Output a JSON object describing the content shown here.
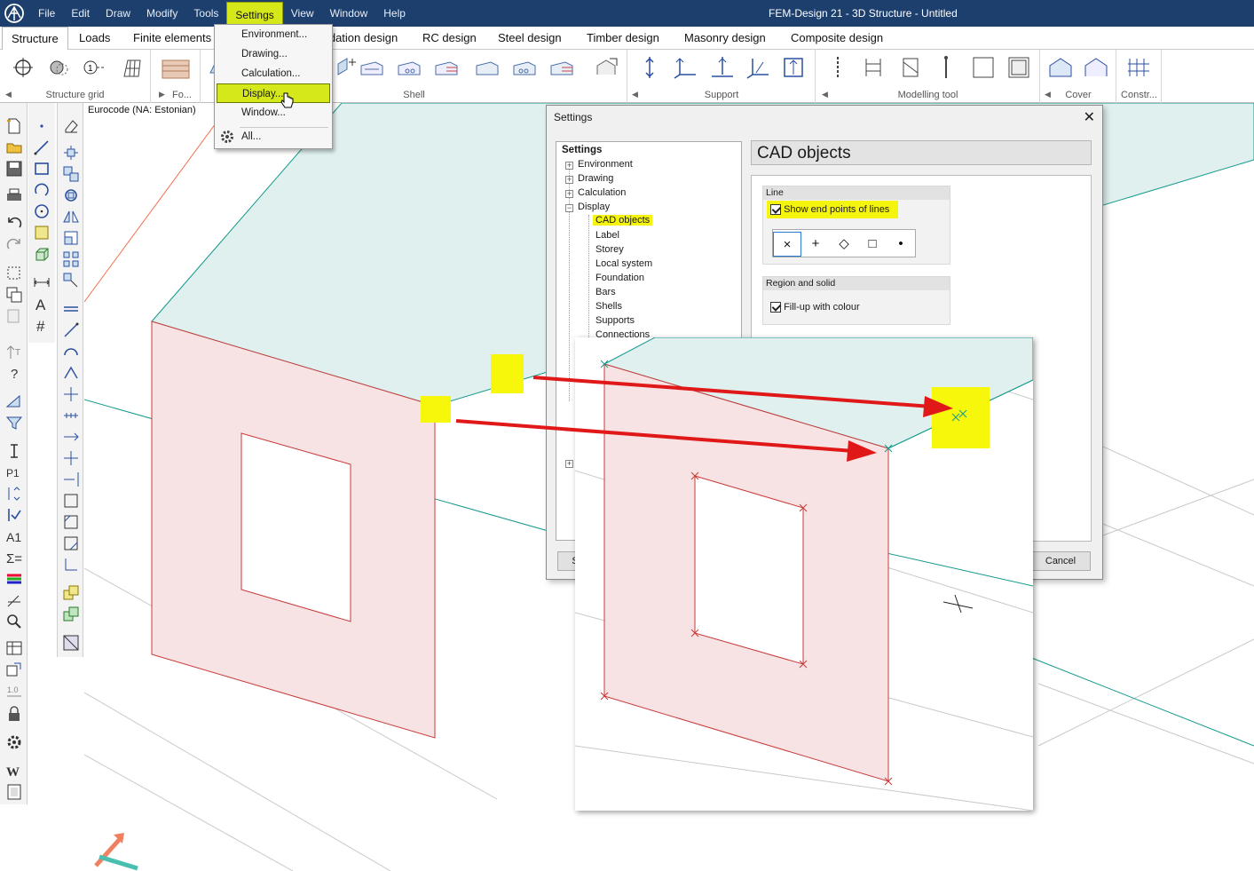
{
  "window": {
    "title": "FEM-Design 21 - 3D Structure - Untitled"
  },
  "menu": [
    "File",
    "Edit",
    "Draw",
    "Modify",
    "Tools",
    "Settings",
    "View",
    "Window",
    "Help"
  ],
  "menu_active": "Settings",
  "ribbon": {
    "tabs": [
      "Structure",
      "Loads",
      "Finite elements",
      "...dation design",
      "RC design",
      "Steel design",
      "Timber design",
      "Masonry design",
      "Composite design"
    ],
    "groups": [
      "Structure grid",
      "Fo...",
      "Shell",
      "Support",
      "Modelling tool",
      "Cover",
      "Constr..."
    ]
  },
  "settings_dropdown": {
    "items": [
      "Environment...",
      "Drawing...",
      "Calculation...",
      "Display...",
      "Window...",
      "All..."
    ],
    "highlighted": "Display..."
  },
  "viewport": {
    "code_label": "Eurocode (NA: Estonian)"
  },
  "dialog": {
    "title": "Settings",
    "tree_root": "Settings",
    "tree_items": [
      "Environment",
      "Drawing",
      "Calculation",
      "Display",
      "CAD objects",
      "Label",
      "Storey",
      "Local system",
      "Foundation",
      "Bars",
      "Shells",
      "Supports",
      "Connections"
    ],
    "selected_item": "CAD objects",
    "panel_title": "CAD objects",
    "line_group": {
      "title": "Line",
      "checkbox_label": "Show end points of lines",
      "checked": true,
      "marker_options": [
        "×",
        "+",
        "◇",
        "□",
        "•"
      ],
      "selected_marker": "×"
    },
    "region_group": {
      "title": "Region and solid",
      "checkbox_label": "Fill-up with colour",
      "checked": true
    },
    "buttons": {
      "left_partial": "S",
      "cancel": "Cancel"
    }
  },
  "colors": {
    "title_bar": "#1c3f6e",
    "highlight": "#d4e81a",
    "annotation_yellow": "#f7f70c",
    "arrow_red": "#e01818",
    "wall_fill": "#f7e3e3",
    "wall_stroke": "#c83a3a",
    "slab_fill": "#dff0ef",
    "grid_green": "#159a8c"
  }
}
